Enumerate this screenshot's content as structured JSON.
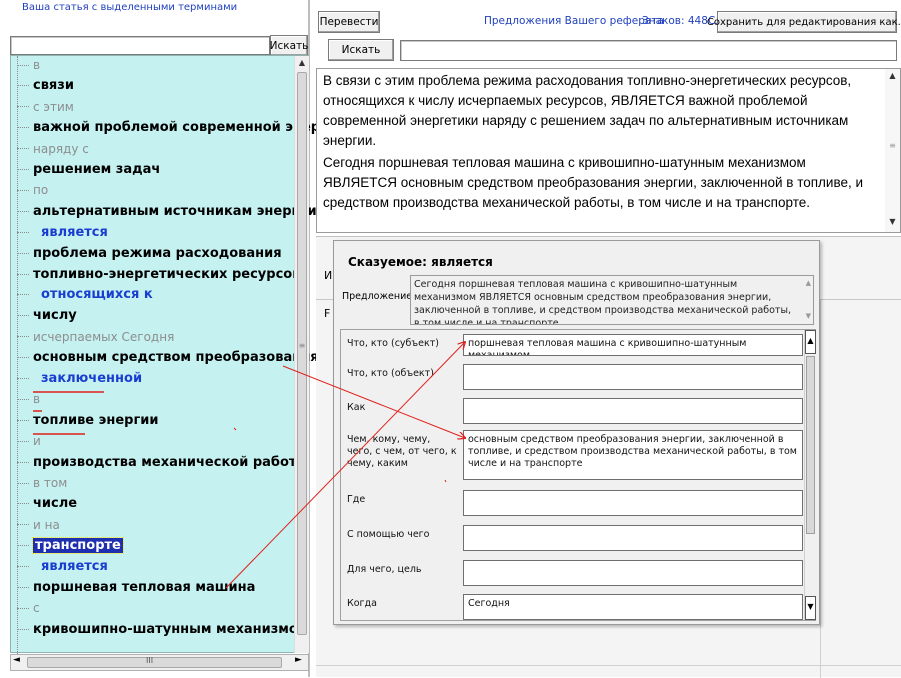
{
  "left": {
    "caption": "Ваша статья с выделенными терминами",
    "search_button": "Искать",
    "search_value": "",
    "tree": [
      {
        "text": "в",
        "kind": "gray"
      },
      {
        "text": "связи",
        "kind": "bold"
      },
      {
        "text": "с этим",
        "kind": "gray"
      },
      {
        "text": "важной проблемой современной энерге",
        "kind": "bold"
      },
      {
        "text": "наряду с",
        "kind": "gray"
      },
      {
        "text": "решением задач",
        "kind": "bold"
      },
      {
        "text": "по",
        "kind": "gray"
      },
      {
        "text": "альтернативным источникам энергии",
        "kind": "bold"
      },
      {
        "text": "является",
        "kind": "blue"
      },
      {
        "text": "проблема режима расходования",
        "kind": "bold"
      },
      {
        "text": "топливно-энергетических ресурсов",
        "kind": "bold"
      },
      {
        "text": "относящихся к",
        "kind": "blue"
      },
      {
        "text": "числу",
        "kind": "bold"
      },
      {
        "text": "исчерпаемых Сегодня",
        "kind": "gray"
      },
      {
        "text": "основным средством преобразования",
        "kind": "bold"
      },
      {
        "text": "заключенной",
        "kind": "blue"
      },
      {
        "text": "в",
        "kind": "gray"
      },
      {
        "text": "топливе энергии",
        "kind": "bold"
      },
      {
        "text": "и",
        "kind": "gray"
      },
      {
        "text": "производства механической работы",
        "kind": "bold"
      },
      {
        "text": "в том",
        "kind": "gray"
      },
      {
        "text": "числе",
        "kind": "bold"
      },
      {
        "text": "и на",
        "kind": "gray"
      },
      {
        "text": "транспорте",
        "kind": "selected"
      },
      {
        "text": "является",
        "kind": "blue"
      },
      {
        "text": "поршневая тепловая машина",
        "kind": "bold"
      },
      {
        "text": "с",
        "kind": "gray"
      },
      {
        "text": "кривошипно-шатунным механизмом",
        "kind": "bold"
      }
    ],
    "hscroll_grip": "III"
  },
  "right": {
    "translate_button": "Перевести",
    "sentences_link": "Предложения Вашего реферата",
    "chars_count": "Знаков: 448",
    "chars_tail": "Сл",
    "save_button": "Сохранить для редактирования как...",
    "search_button": "Искать",
    "search_value": "",
    "paragraph_1": "В связи с этим проблема режима расходования топливно-энергетических ресурсов, относящихся к числу исчерпаемых ресурсов, ЯВЛЯЕТСЯ важной проблемой современной энергетики наряду с решением задач по альтернативным источникам энергии.",
    "paragraph_2": "Сегодня поршневая тепловая машина с кривошипно-шатунным механизмом ЯВЛЯЕТСЯ основным средством преобразования энергии, заключенной в топливе, и средством производства механической работы, в том числе и на транспорте.",
    "behind_label_1": "И:",
    "behind_label_2": "F"
  },
  "dialog": {
    "title": "Сказуемое: является",
    "sentence_label": "Предложение:",
    "sentence_text": "Сегодня поршневая тепловая машина с кривошипно-шатунным механизмом ЯВЛЯЕТСЯ основным средством преобразования энергии, заключенной в топливе, и средством производства механической работы, в том числе и на транспорте",
    "fields": [
      {
        "label": "Что, кто (субъект)",
        "value": "поршневая тепловая машина  с  кривошипно-шатунным механизмом"
      },
      {
        "label": "Что, кто (объект)",
        "value": ""
      },
      {
        "label": "Как",
        "value": ""
      },
      {
        "label": "Чем, кому, чему, чего, с чем, от чего, к чему, каким",
        "value": "основным средством преобразования энергии, заключенной  в топливе, и  средством производства механической работы, в том  числе и на  транспорте"
      },
      {
        "label": "Где",
        "value": ""
      },
      {
        "label": "С помощью чего",
        "value": ""
      },
      {
        "label": "Для чего, цель",
        "value": ""
      },
      {
        "label": "Когда",
        "value": "Сегодня"
      }
    ]
  },
  "colors": {
    "tree_background": "#c5f1f1",
    "link_blue": "#1f3fbf",
    "annotation_red": "#e0201a",
    "selection": "#1e2fb0"
  }
}
